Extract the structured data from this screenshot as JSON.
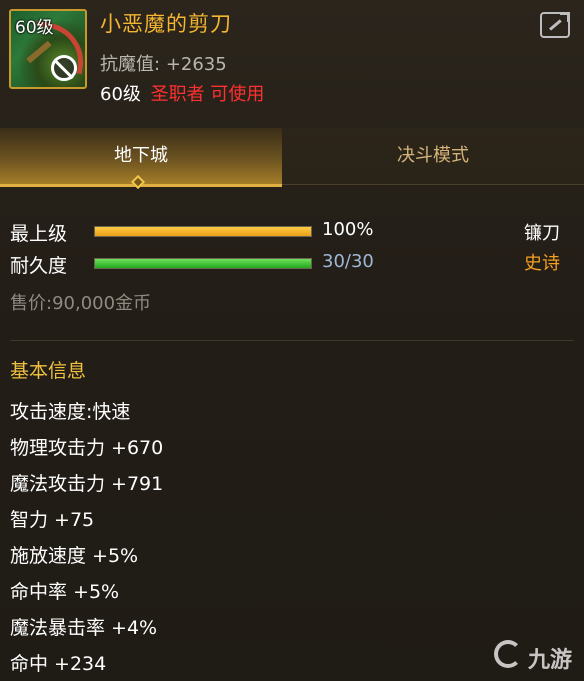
{
  "header": {
    "icon_level": "60级",
    "title": "小恶魔的剪刀",
    "resist_label": "抗魔值:",
    "resist_value": "+2635",
    "req_level": "60级",
    "req_class": "圣职者 可使用"
  },
  "tabs": [
    {
      "label": "地下城",
      "active": true
    },
    {
      "label": "决斗模式",
      "active": false
    }
  ],
  "bars": {
    "grade_label": "最上级",
    "grade_value": "100%",
    "grade_fraction": 1.0,
    "durability_label": "耐久度",
    "durability_value": "30/30",
    "durability_fraction": 1.0
  },
  "item_type": "镰刀",
  "rarity": "史诗",
  "price": "售价:90,000金币",
  "basic_title": "基本信息",
  "attributes": [
    "攻击速度:快速",
    "物理攻击力 +670",
    "魔法攻击力 +791",
    "智力 +75",
    "施放速度 +5%",
    "命中率 +5%",
    "魔法暴击率 +4%",
    "命中 +234"
  ],
  "watermark": "九游",
  "colors": {
    "title_gold": "#f4b530",
    "class_red": "#ff3030",
    "rarity_orange": "#f4a020",
    "section_gold": "#f0c040",
    "durability_blue": "#9fb7d6"
  },
  "icons": [
    "item-scythe-icon",
    "forbidden-icon",
    "share-icon",
    "tab-diamond-icon"
  ]
}
